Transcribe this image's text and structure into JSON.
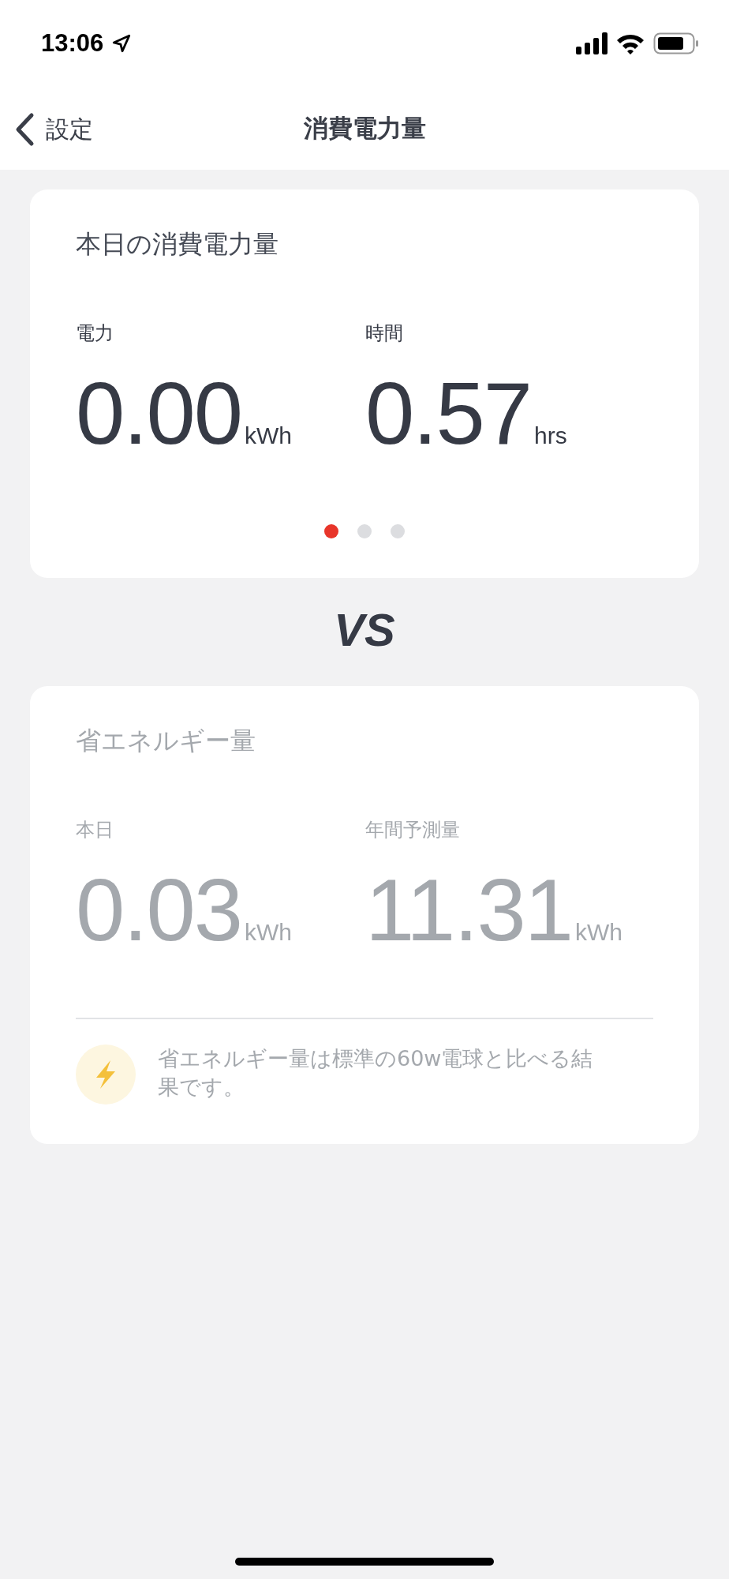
{
  "status_bar": {
    "time": "13:06"
  },
  "nav": {
    "back_label": "設定",
    "title": "消費電力量"
  },
  "cards": [
    {
      "title": "本日の消費電力量",
      "disabled": false,
      "metrics": [
        {
          "label": "電力",
          "value": "0.00",
          "unit": "kWh"
        },
        {
          "label": "時間",
          "value": "0.57",
          "unit": "hrs"
        }
      ],
      "pager": [
        {
          "selected": true
        },
        {
          "selected": false
        },
        {
          "selected": false
        }
      ]
    },
    {
      "title": "省エネルギー量",
      "disabled": true,
      "metrics": [
        {
          "label": "本日",
          "value": "0.03",
          "unit": "kWh"
        },
        {
          "label": "年間予測量",
          "value": "11.31",
          "unit": "kWh"
        }
      ],
      "note": "省エネルギー量は標準の60w電球と比べる結果です。"
    }
  ],
  "separator": "VS"
}
